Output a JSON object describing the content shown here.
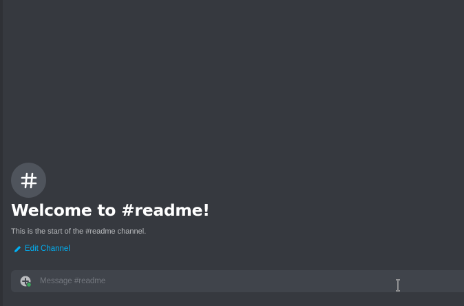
{
  "channel": {
    "icon": "hash-icon",
    "welcome_title": "Welcome to #readme!",
    "welcome_subtitle": "This is the start of the #readme channel.",
    "edit_label": "Edit Channel",
    "edit_icon": "pencil-icon"
  },
  "composer": {
    "placeholder": "Message #readme",
    "value": "",
    "attach_icon": "plus-circle-icon"
  },
  "colors": {
    "background": "#36393f",
    "link": "#00b0f4",
    "composer_bg": "#40444b",
    "status_online": "#3ba55c"
  }
}
